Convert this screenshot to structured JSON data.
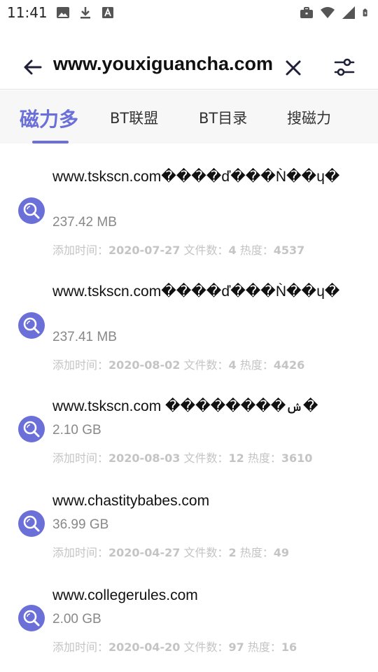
{
  "status_bar": {
    "time": "11:41",
    "left_icons": [
      "image-icon",
      "download-icon",
      "font-icon"
    ],
    "right_icons": [
      "briefcase-icon",
      "wifi-icon",
      "signal-icon",
      "battery-charging-icon"
    ]
  },
  "search": {
    "query": "www.youxiguancha.com",
    "icons": {
      "back": "arrow-left-icon",
      "clear": "close-icon",
      "filter": "sliders-icon"
    }
  },
  "tabs": [
    {
      "label": "磁力多",
      "active": true
    },
    {
      "label": "BT联盟",
      "active": false
    },
    {
      "label": "BT目录",
      "active": false
    },
    {
      "label": "搜磁力",
      "active": false
    }
  ],
  "accent_color": "#6b6fd8",
  "meta_labels": {
    "added": "添加时间：",
    "files": "文件数：",
    "heat": "热度："
  },
  "results": [
    {
      "title": "www.tskscn.com����ď���Ǹ��ɥ�",
      "size": "237.42 MB",
      "date": "2020-07-27",
      "files": "4",
      "heat": "4537"
    },
    {
      "title": "www.tskscn.com����ď���Ǹ��ɥ�",
      "size": "237.41 MB",
      "date": "2020-08-02",
      "files": "4",
      "heat": "4426"
    },
    {
      "title": "www.tskscn.com ��������ݾ�",
      "size": "2.10 GB",
      "date": "2020-08-03",
      "files": "12",
      "heat": "3610"
    },
    {
      "title": "www.chastitybabes.com",
      "size": "36.99 GB",
      "date": "2020-04-27",
      "files": "2",
      "heat": "49"
    },
    {
      "title": "www.collegerules.com",
      "size": "2.00 GB",
      "date": "2020-04-20",
      "files": "97",
      "heat": "16"
    }
  ]
}
